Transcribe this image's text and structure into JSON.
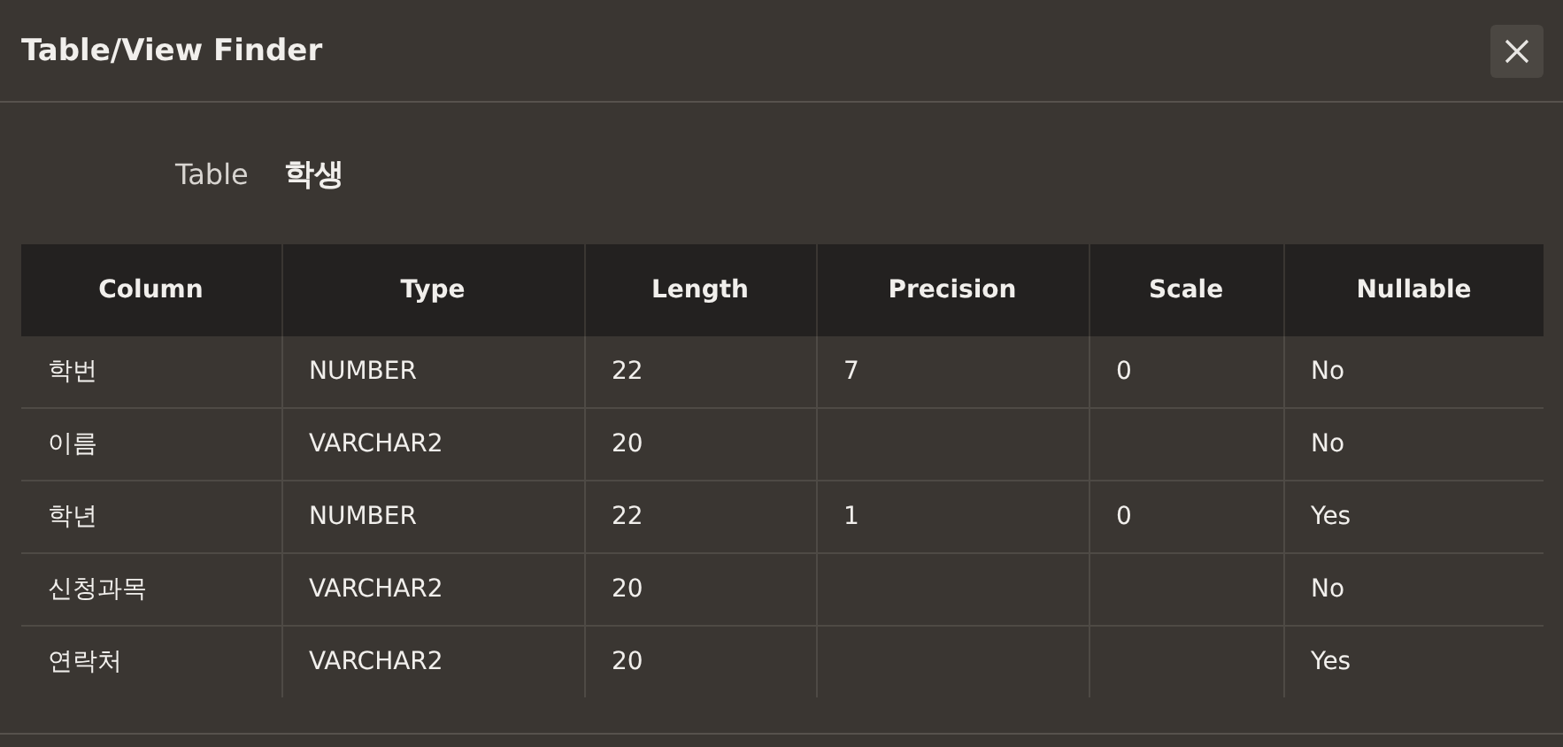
{
  "window": {
    "title": "Table/View Finder"
  },
  "table_field": {
    "label": "Table",
    "value": "학생"
  },
  "table": {
    "columns": [
      "Column",
      "Type",
      "Length",
      "Precision",
      "Scale",
      "Nullable"
    ],
    "rows": [
      [
        "학번",
        "NUMBER",
        "22",
        "7",
        "0",
        "No"
      ],
      [
        "이름",
        "VARCHAR2",
        "20",
        "",
        "",
        "No"
      ],
      [
        "학년",
        "NUMBER",
        "22",
        "1",
        "0",
        "Yes"
      ],
      [
        "신청과목",
        "VARCHAR2",
        "20",
        "",
        "",
        "No"
      ],
      [
        "연락처",
        "VARCHAR2",
        "20",
        "",
        "",
        "Yes"
      ]
    ]
  }
}
